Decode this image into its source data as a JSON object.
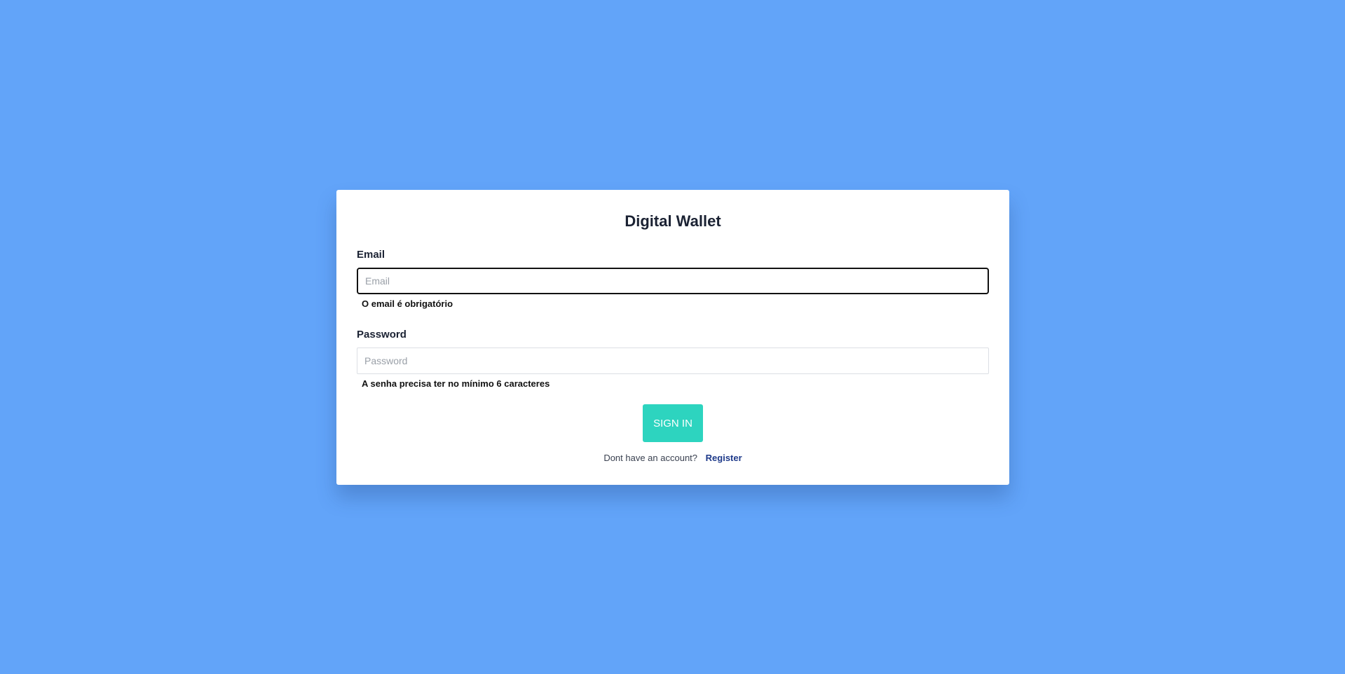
{
  "app": {
    "title": "Digital Wallet"
  },
  "colors": {
    "background": "#62a4f9",
    "card": "#ffffff",
    "primary_button": "#2dd4bf",
    "link": "#1e3a8a"
  },
  "login_form": {
    "email": {
      "label": "Email",
      "value": "",
      "placeholder": "Email",
      "error": "O email é obrigatório"
    },
    "password": {
      "label": "Password",
      "value": "",
      "placeholder": "Password",
      "error": "A senha precisa ter no mínimo 6 caracteres"
    },
    "submit_label": "SIGN IN",
    "register_prompt": "Dont have an account?",
    "register_link": "Register"
  }
}
